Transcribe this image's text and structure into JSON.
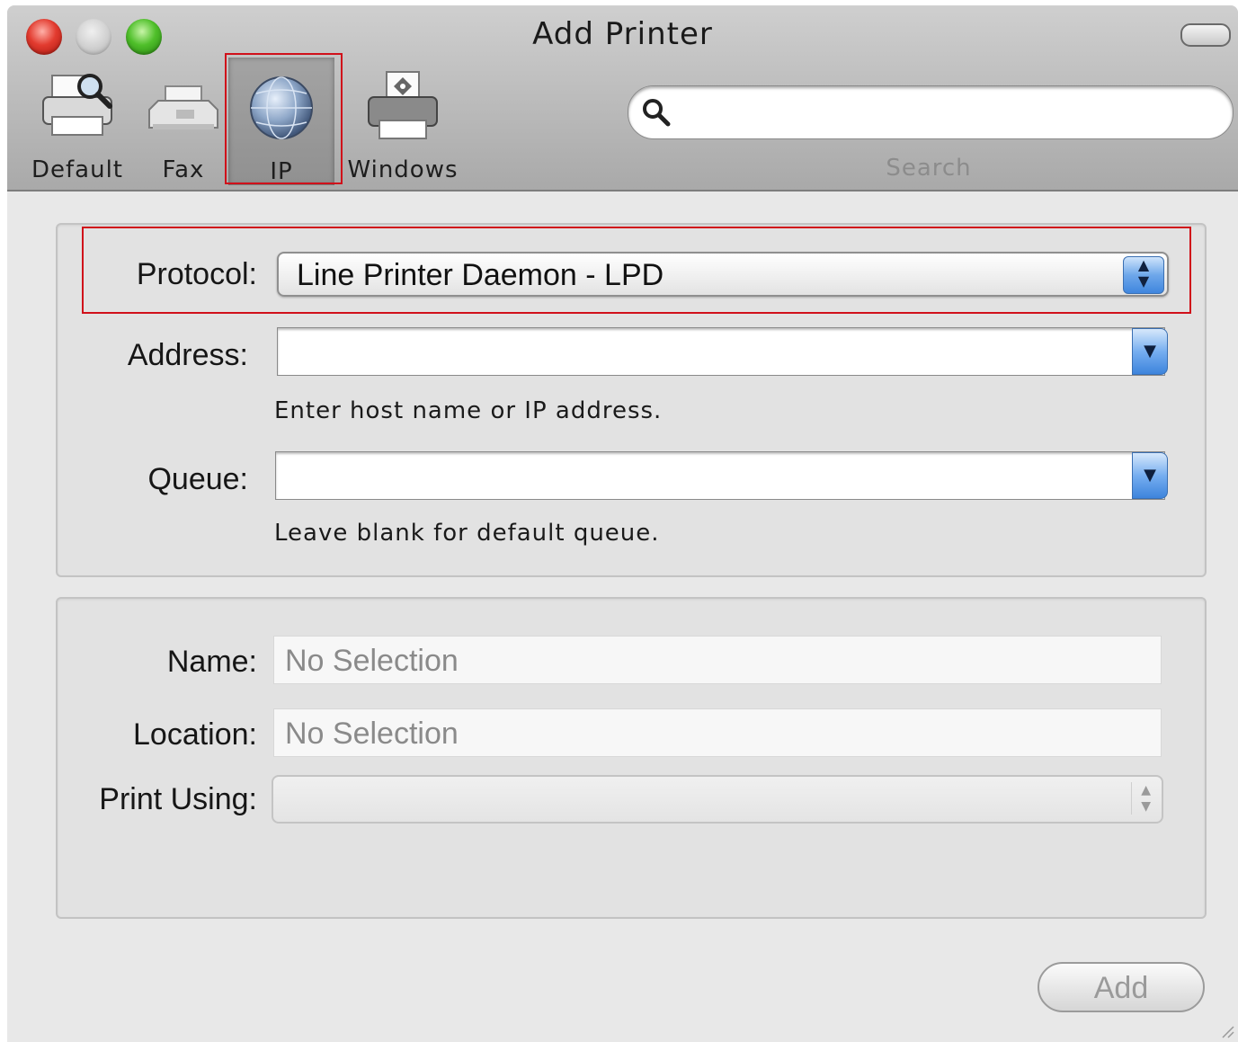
{
  "window": {
    "title": "Add Printer"
  },
  "toolbar": {
    "items": [
      {
        "label": "Default",
        "icon": "printer-search-icon",
        "selected": false
      },
      {
        "label": "Fax",
        "icon": "fax-icon",
        "selected": false
      },
      {
        "label": "IP",
        "icon": "globe-icon",
        "selected": true
      },
      {
        "label": "Windows",
        "icon": "windows-printer-icon",
        "selected": false
      }
    ],
    "search_label": "Search",
    "search_value": ""
  },
  "connection": {
    "protocol_label": "Protocol:",
    "protocol_value": "Line Printer Daemon - LPD",
    "address_label": "Address:",
    "address_value": "",
    "address_hint": "Enter host name or IP address.",
    "queue_label": "Queue:",
    "queue_value": "",
    "queue_hint": "Leave blank for default queue."
  },
  "details": {
    "name_label": "Name:",
    "name_placeholder": "No Selection",
    "location_label": "Location:",
    "location_placeholder": "No Selection",
    "print_using_label": "Print Using:",
    "print_using_value": ""
  },
  "footer": {
    "add_label": "Add"
  },
  "colors": {
    "highlight": "#d0101a",
    "accent_blue": "#3f86de"
  }
}
